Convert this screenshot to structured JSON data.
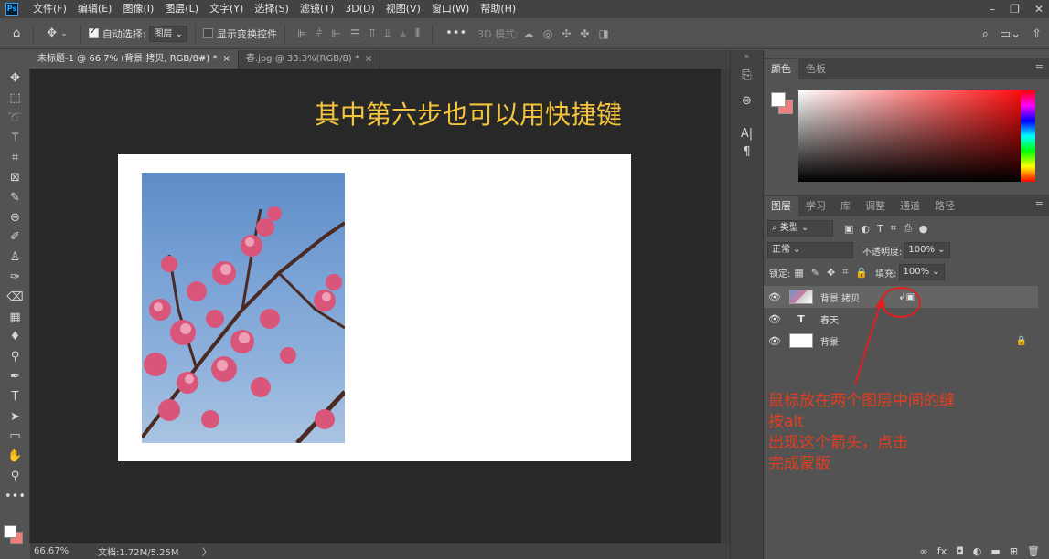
{
  "app": {
    "logo": "Ps"
  },
  "menu": [
    "文件(F)",
    "编辑(E)",
    "图像(I)",
    "图层(L)",
    "文字(Y)",
    "选择(S)",
    "滤镜(T)",
    "3D(D)",
    "视图(V)",
    "窗口(W)",
    "帮助(H)"
  ],
  "options_bar": {
    "auto_select_label": "自动选择:",
    "auto_select_target": "图层",
    "show_transform_label": "显示变换控件",
    "mode_3d_label": "3D 模式:"
  },
  "document_tabs": [
    {
      "title": "未标题-1 @ 66.7% (背景 拷贝, RGB/8#) *",
      "close": "×"
    },
    {
      "title": "春.jpg @ 33.3%(RGB/8) *",
      "close": "×"
    }
  ],
  "canvas": {
    "annotation": "其中第六步也可以用快捷键"
  },
  "status": {
    "zoom": "66.67%",
    "doc_info": "文档:1.72M/5.25M",
    "arrow": "〉"
  },
  "color_panel": {
    "tabs": [
      "颜色",
      "色板"
    ]
  },
  "layers_panel": {
    "tabs": [
      "图层",
      "学习",
      "库",
      "调整",
      "通道",
      "路径"
    ],
    "filter_label": "类型",
    "blend_mode": "正常",
    "opacity_label": "不透明度:",
    "opacity_value": "100%",
    "lock_label": "锁定:",
    "fill_label": "填充:",
    "fill_value": "100%",
    "layers": [
      {
        "name": "背景 拷贝",
        "kind": "image",
        "selected": true
      },
      {
        "name": "春天",
        "kind": "text",
        "selected": false
      },
      {
        "name": "背景",
        "kind": "background",
        "selected": false
      }
    ],
    "annotation": "鼠标放在两个图层中间的缝\n按alt\n出现这个箭头，点击\n完成蒙版"
  },
  "colors": {
    "accent_yellow": "#f4c43c",
    "annotation_red": "#e83c1e",
    "circle_red": "#e02020"
  }
}
